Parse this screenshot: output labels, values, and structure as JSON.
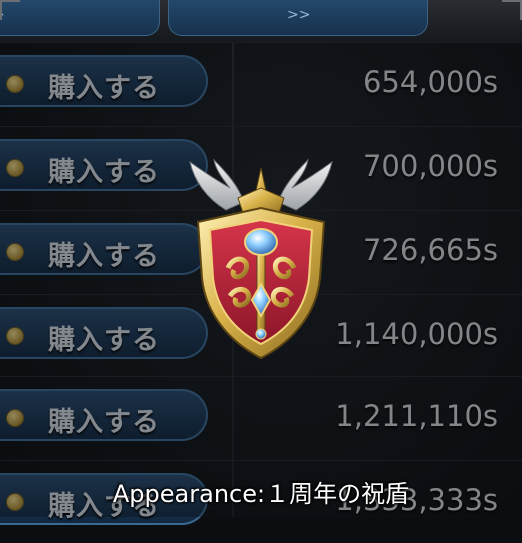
{
  "tabs": [
    {
      "label": ">"
    },
    {
      "label": ">>"
    }
  ],
  "shop_rows": [
    {
      "button_label": "購入する",
      "price": "654,000s"
    },
    {
      "button_label": "購入する",
      "price": "700,000s"
    },
    {
      "button_label": "購入する",
      "price": "726,665s"
    },
    {
      "button_label": "購入する",
      "price": "1,140,000s"
    },
    {
      "button_label": "購入する",
      "price": "1,211,110s"
    },
    {
      "button_label": "購入する",
      "price": "1,333,333s"
    }
  ],
  "shield_item": {
    "icon": "anniversary-shield-icon",
    "caption": "Appearance:１周年の祝盾"
  },
  "colors": {
    "button_blue": "#1a3553",
    "shield_red": "#b8243a",
    "shield_gold": "#d9b24a"
  }
}
